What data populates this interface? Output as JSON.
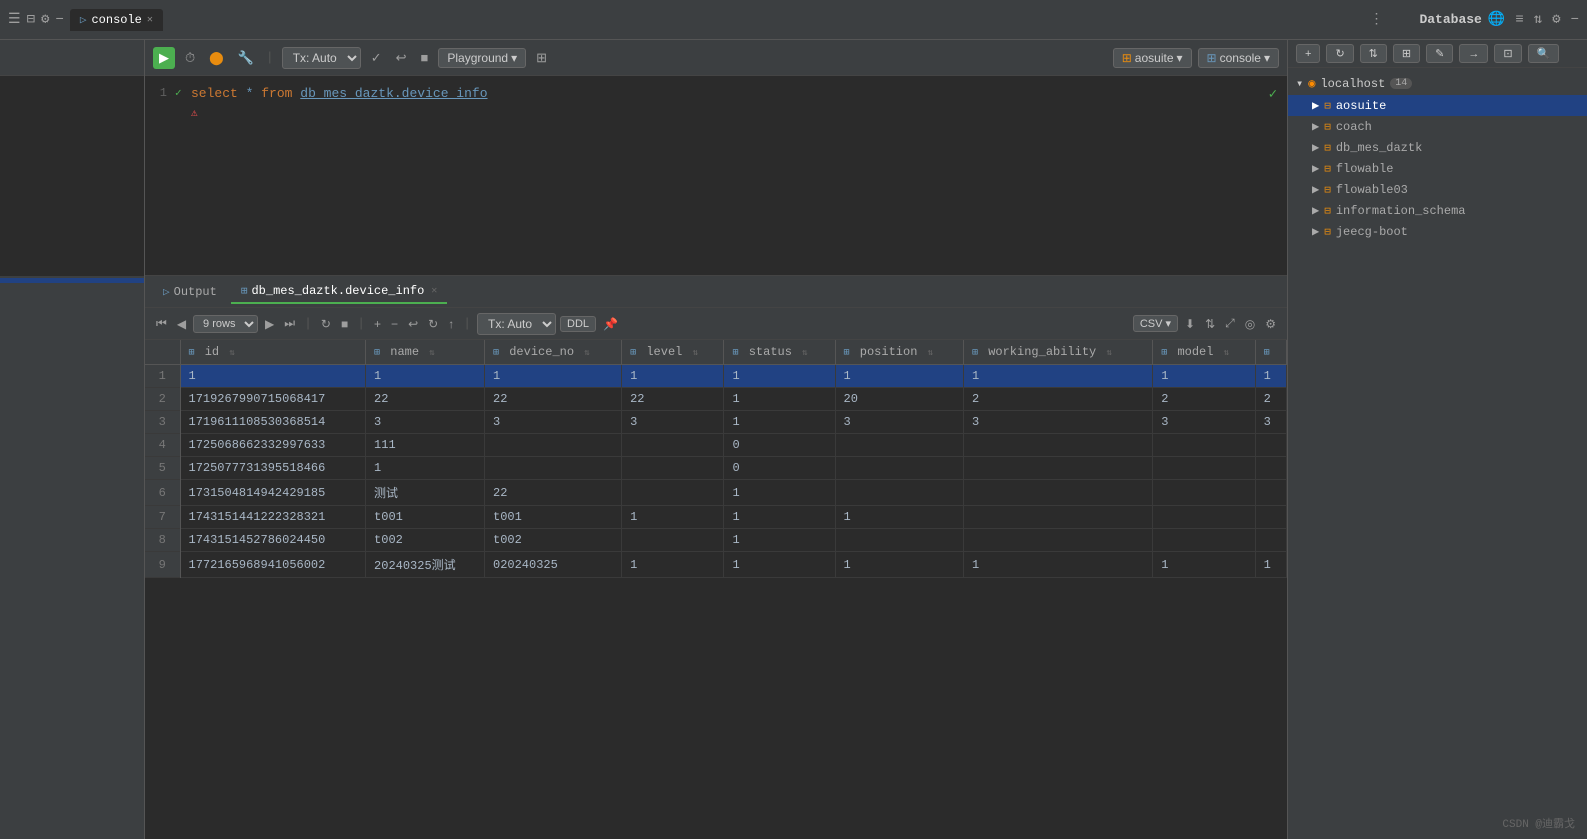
{
  "tabs": [
    {
      "label": "console",
      "icon": "▶",
      "active": true,
      "closeable": true
    }
  ],
  "editor_toolbar": {
    "run_label": "▶",
    "tx_label": "Tx: Auto",
    "check_label": "✓",
    "undo_label": "↩",
    "stop_label": "■",
    "playground_label": "Playground",
    "dropdown_icon": "▾",
    "table_icon": "⊞",
    "aosuite_label": "aosuite",
    "console_label": "console"
  },
  "editor": {
    "line1": {
      "number": "1",
      "check": "✓",
      "content_select": "select",
      "content_star": " * ",
      "content_from": "from",
      "content_table": " db_mes_daztk.device_info",
      "error_icon": "⚠"
    }
  },
  "output": {
    "tabs": [
      {
        "label": "Output",
        "icon": "▷",
        "active": false
      },
      {
        "label": "db_mes_daztk.device_info",
        "icon": "⊞",
        "active": true,
        "closeable": true
      }
    ],
    "data_toolbar": {
      "first_icon": "⏮",
      "prev_icon": "◀",
      "rows_label": "9 rows",
      "next_icon": "▶",
      "last_icon": "⏭",
      "refresh_icon": "↻",
      "stop_icon": "■",
      "add_icon": "+",
      "minus_icon": "−",
      "undo_icon": "↩",
      "redo_icon": "↻",
      "up_icon": "↑",
      "tx_label": "Tx: Auto",
      "ddl_label": "DDL",
      "pin_icon": "📌",
      "csv_label": "CSV",
      "download_icon": "⬇",
      "filter_icon": "⇅",
      "expand_icon": "⤢",
      "view_icon": "◎",
      "settings_icon": "⚙"
    },
    "columns": [
      {
        "label": "id",
        "icon": "⊞"
      },
      {
        "label": "name",
        "icon": "⊞"
      },
      {
        "label": "device_no",
        "icon": "⊞"
      },
      {
        "label": "level",
        "icon": "⊞"
      },
      {
        "label": "status",
        "icon": "⊞"
      },
      {
        "label": "position",
        "icon": "⊞"
      },
      {
        "label": "working_ability",
        "icon": "⊞"
      },
      {
        "label": "model",
        "icon": "⊞"
      }
    ],
    "rows": [
      {
        "num": "1",
        "id": "1",
        "name": "1",
        "device_no": "1",
        "level": "1",
        "status": "1",
        "position": "1",
        "working_ability": "1",
        "model": "1",
        "extra": "1"
      },
      {
        "num": "2",
        "id": "1719267990715068417",
        "name": "22",
        "device_no": "22",
        "level": "22",
        "status": "1",
        "position": "20",
        "working_ability": "2",
        "model": "2",
        "extra": "2"
      },
      {
        "num": "3",
        "id": "1719611108530368514",
        "name": "3",
        "device_no": "3",
        "level": "3",
        "status": "1",
        "position": "3",
        "working_ability": "3",
        "model": "3",
        "extra": "3"
      },
      {
        "num": "4",
        "id": "1725068662332997633",
        "name": "111",
        "device_no": "",
        "level": "",
        "status": "0",
        "position": "",
        "working_ability": "",
        "model": "",
        "extra": ""
      },
      {
        "num": "5",
        "id": "1725077731395518466",
        "name": "1",
        "device_no": "",
        "level": "",
        "status": "0",
        "position": "",
        "working_ability": "",
        "model": "",
        "extra": ""
      },
      {
        "num": "6",
        "id": "1731504814942429185",
        "name": "测试",
        "device_no": "22",
        "level": "",
        "status": "1",
        "position": "",
        "working_ability": "",
        "model": "",
        "extra": ""
      },
      {
        "num": "7",
        "id": "1743151441222328321",
        "name": "t001",
        "device_no": "t001",
        "level": "1",
        "status": "1",
        "position": "1",
        "working_ability": "",
        "model": "",
        "extra": ""
      },
      {
        "num": "8",
        "id": "1743151452786024450",
        "name": "t002",
        "device_no": "t002",
        "level": "",
        "status": "1",
        "position": "",
        "working_ability": "",
        "model": "",
        "extra": ""
      },
      {
        "num": "9",
        "id": "1772165968941056002",
        "name": "20240325测试",
        "device_no": "020240325",
        "level": "1",
        "status": "1",
        "position": "1",
        "working_ability": "1",
        "model": "1",
        "extra": "1"
      }
    ]
  },
  "database_panel": {
    "title": "Database",
    "host": {
      "label": "localhost",
      "badge": "14"
    },
    "items": [
      {
        "label": "aosuite",
        "selected": true
      },
      {
        "label": "coach"
      },
      {
        "label": "db_mes_daztk"
      },
      {
        "label": "flowable"
      },
      {
        "label": "flowable03"
      },
      {
        "label": "information_schema"
      },
      {
        "label": "jeecg-boot"
      }
    ]
  },
  "footer": {
    "text": "CSDN @迪霸戈"
  }
}
